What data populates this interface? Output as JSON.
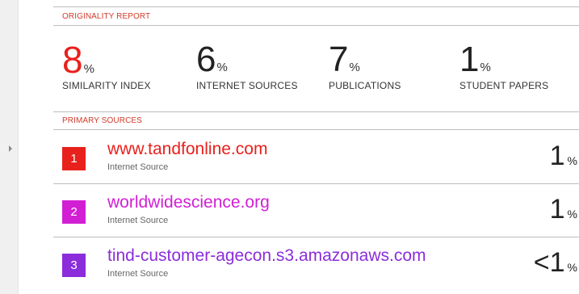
{
  "report": {
    "title": "ORIGINALITY REPORT",
    "metrics": [
      {
        "value": "8",
        "unit": "%",
        "label": "SIMILARITY INDEX"
      },
      {
        "value": "6",
        "unit": "%",
        "label": "INTERNET SOURCES"
      },
      {
        "value": "7",
        "unit": "%",
        "label": "PUBLICATIONS"
      },
      {
        "value": "1",
        "unit": "%",
        "label": "STUDENT PAPERS"
      }
    ],
    "primary_title": "PRIMARY SOURCES",
    "sources": [
      {
        "rank": "1",
        "name": "www.tandfonline.com",
        "type": "Internet Source",
        "value": "1",
        "unit": "%",
        "color": "#e8211c"
      },
      {
        "rank": "2",
        "name": "worldwidescience.org",
        "type": "Internet Source",
        "value": "1",
        "unit": "%",
        "color": "#d21fd4"
      },
      {
        "rank": "3",
        "name": "tind-customer-agecon.s3.amazonaws.com",
        "type": "Internet Source",
        "value": "<1",
        "unit": "%",
        "color": "#8b2ddb"
      }
    ]
  }
}
